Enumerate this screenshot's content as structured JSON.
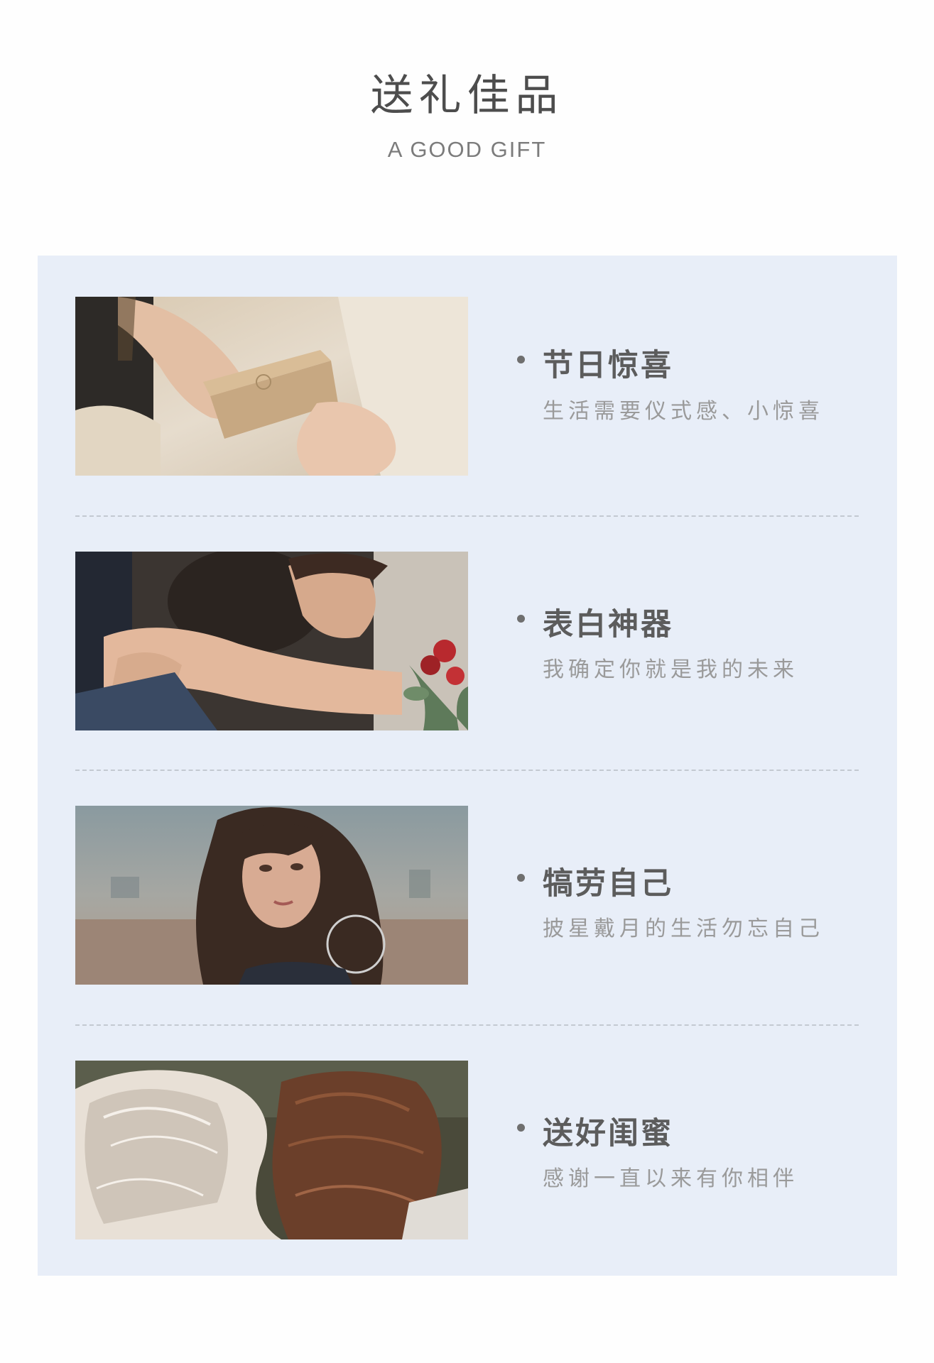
{
  "header": {
    "title": "送礼佳品",
    "subtitle": "A GOOD GIFT"
  },
  "items": [
    {
      "title": "节日惊喜",
      "desc": "生活需要仪式感、小惊喜",
      "photo_subject": "hands-passing-gift-box"
    },
    {
      "title": "表白神器",
      "desc": "我确定你就是我的未来",
      "photo_subject": "couple-hug-with-roses"
    },
    {
      "title": "犒劳自己",
      "desc": "披星戴月的生活勿忘自己",
      "photo_subject": "woman-looking-over-shoulder"
    },
    {
      "title": "送好闺蜜",
      "desc": "感谢一直以来有你相伴",
      "photo_subject": "two-friends-windblown-hair"
    }
  ],
  "colors": {
    "page_background": "#fefefe",
    "panel_background": "#e8eef8",
    "title_text": "#4d4d4d",
    "item_title_text": "#5c5c5c",
    "item_desc_text": "#9a9a9a",
    "divider": "#c3c9d1"
  }
}
